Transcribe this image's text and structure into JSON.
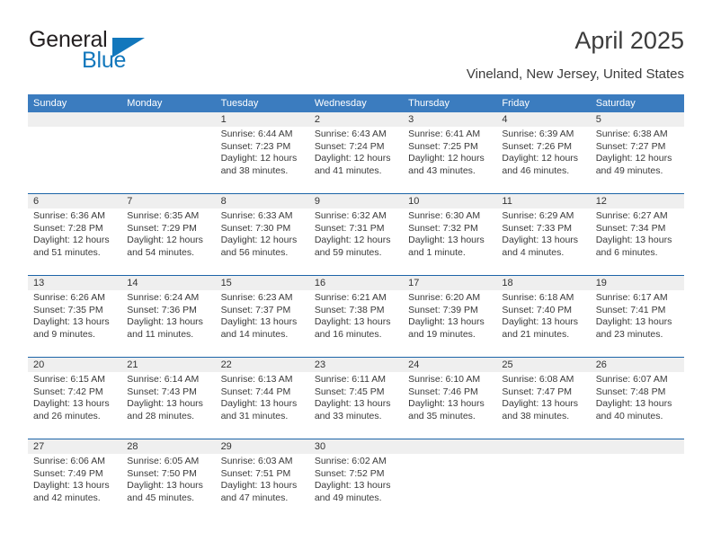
{
  "brand": {
    "name_part1": "General",
    "name_part2": "Blue",
    "flag_icon": "triangle-flag-icon"
  },
  "header": {
    "month_title": "April 2025",
    "location": "Vineland, New Jersey, United States"
  },
  "colors": {
    "header_blue": "#3b7cbf",
    "separator_blue": "#1d65a8",
    "band_gray": "#efefef",
    "brand_blue": "#1277bc",
    "text": "#3a3a3a"
  },
  "calendar": {
    "weekday_headers": [
      "Sunday",
      "Monday",
      "Tuesday",
      "Wednesday",
      "Thursday",
      "Friday",
      "Saturday"
    ],
    "weeks": [
      [
        {
          "day": "",
          "sunrise": "",
          "sunset": "",
          "daylight_line1": "",
          "daylight_line2": ""
        },
        {
          "day": "",
          "sunrise": "",
          "sunset": "",
          "daylight_line1": "",
          "daylight_line2": ""
        },
        {
          "day": "1",
          "sunrise": "Sunrise: 6:44 AM",
          "sunset": "Sunset: 7:23 PM",
          "daylight_line1": "Daylight: 12 hours",
          "daylight_line2": "and 38 minutes."
        },
        {
          "day": "2",
          "sunrise": "Sunrise: 6:43 AM",
          "sunset": "Sunset: 7:24 PM",
          "daylight_line1": "Daylight: 12 hours",
          "daylight_line2": "and 41 minutes."
        },
        {
          "day": "3",
          "sunrise": "Sunrise: 6:41 AM",
          "sunset": "Sunset: 7:25 PM",
          "daylight_line1": "Daylight: 12 hours",
          "daylight_line2": "and 43 minutes."
        },
        {
          "day": "4",
          "sunrise": "Sunrise: 6:39 AM",
          "sunset": "Sunset: 7:26 PM",
          "daylight_line1": "Daylight: 12 hours",
          "daylight_line2": "and 46 minutes."
        },
        {
          "day": "5",
          "sunrise": "Sunrise: 6:38 AM",
          "sunset": "Sunset: 7:27 PM",
          "daylight_line1": "Daylight: 12 hours",
          "daylight_line2": "and 49 minutes."
        }
      ],
      [
        {
          "day": "6",
          "sunrise": "Sunrise: 6:36 AM",
          "sunset": "Sunset: 7:28 PM",
          "daylight_line1": "Daylight: 12 hours",
          "daylight_line2": "and 51 minutes."
        },
        {
          "day": "7",
          "sunrise": "Sunrise: 6:35 AM",
          "sunset": "Sunset: 7:29 PM",
          "daylight_line1": "Daylight: 12 hours",
          "daylight_line2": "and 54 minutes."
        },
        {
          "day": "8",
          "sunrise": "Sunrise: 6:33 AM",
          "sunset": "Sunset: 7:30 PM",
          "daylight_line1": "Daylight: 12 hours",
          "daylight_line2": "and 56 minutes."
        },
        {
          "day": "9",
          "sunrise": "Sunrise: 6:32 AM",
          "sunset": "Sunset: 7:31 PM",
          "daylight_line1": "Daylight: 12 hours",
          "daylight_line2": "and 59 minutes."
        },
        {
          "day": "10",
          "sunrise": "Sunrise: 6:30 AM",
          "sunset": "Sunset: 7:32 PM",
          "daylight_line1": "Daylight: 13 hours",
          "daylight_line2": "and 1 minute."
        },
        {
          "day": "11",
          "sunrise": "Sunrise: 6:29 AM",
          "sunset": "Sunset: 7:33 PM",
          "daylight_line1": "Daylight: 13 hours",
          "daylight_line2": "and 4 minutes."
        },
        {
          "day": "12",
          "sunrise": "Sunrise: 6:27 AM",
          "sunset": "Sunset: 7:34 PM",
          "daylight_line1": "Daylight: 13 hours",
          "daylight_line2": "and 6 minutes."
        }
      ],
      [
        {
          "day": "13",
          "sunrise": "Sunrise: 6:26 AM",
          "sunset": "Sunset: 7:35 PM",
          "daylight_line1": "Daylight: 13 hours",
          "daylight_line2": "and 9 minutes."
        },
        {
          "day": "14",
          "sunrise": "Sunrise: 6:24 AM",
          "sunset": "Sunset: 7:36 PM",
          "daylight_line1": "Daylight: 13 hours",
          "daylight_line2": "and 11 minutes."
        },
        {
          "day": "15",
          "sunrise": "Sunrise: 6:23 AM",
          "sunset": "Sunset: 7:37 PM",
          "daylight_line1": "Daylight: 13 hours",
          "daylight_line2": "and 14 minutes."
        },
        {
          "day": "16",
          "sunrise": "Sunrise: 6:21 AM",
          "sunset": "Sunset: 7:38 PM",
          "daylight_line1": "Daylight: 13 hours",
          "daylight_line2": "and 16 minutes."
        },
        {
          "day": "17",
          "sunrise": "Sunrise: 6:20 AM",
          "sunset": "Sunset: 7:39 PM",
          "daylight_line1": "Daylight: 13 hours",
          "daylight_line2": "and 19 minutes."
        },
        {
          "day": "18",
          "sunrise": "Sunrise: 6:18 AM",
          "sunset": "Sunset: 7:40 PM",
          "daylight_line1": "Daylight: 13 hours",
          "daylight_line2": "and 21 minutes."
        },
        {
          "day": "19",
          "sunrise": "Sunrise: 6:17 AM",
          "sunset": "Sunset: 7:41 PM",
          "daylight_line1": "Daylight: 13 hours",
          "daylight_line2": "and 23 minutes."
        }
      ],
      [
        {
          "day": "20",
          "sunrise": "Sunrise: 6:15 AM",
          "sunset": "Sunset: 7:42 PM",
          "daylight_line1": "Daylight: 13 hours",
          "daylight_line2": "and 26 minutes."
        },
        {
          "day": "21",
          "sunrise": "Sunrise: 6:14 AM",
          "sunset": "Sunset: 7:43 PM",
          "daylight_line1": "Daylight: 13 hours",
          "daylight_line2": "and 28 minutes."
        },
        {
          "day": "22",
          "sunrise": "Sunrise: 6:13 AM",
          "sunset": "Sunset: 7:44 PM",
          "daylight_line1": "Daylight: 13 hours",
          "daylight_line2": "and 31 minutes."
        },
        {
          "day": "23",
          "sunrise": "Sunrise: 6:11 AM",
          "sunset": "Sunset: 7:45 PM",
          "daylight_line1": "Daylight: 13 hours",
          "daylight_line2": "and 33 minutes."
        },
        {
          "day": "24",
          "sunrise": "Sunrise: 6:10 AM",
          "sunset": "Sunset: 7:46 PM",
          "daylight_line1": "Daylight: 13 hours",
          "daylight_line2": "and 35 minutes."
        },
        {
          "day": "25",
          "sunrise": "Sunrise: 6:08 AM",
          "sunset": "Sunset: 7:47 PM",
          "daylight_line1": "Daylight: 13 hours",
          "daylight_line2": "and 38 minutes."
        },
        {
          "day": "26",
          "sunrise": "Sunrise: 6:07 AM",
          "sunset": "Sunset: 7:48 PM",
          "daylight_line1": "Daylight: 13 hours",
          "daylight_line2": "and 40 minutes."
        }
      ],
      [
        {
          "day": "27",
          "sunrise": "Sunrise: 6:06 AM",
          "sunset": "Sunset: 7:49 PM",
          "daylight_line1": "Daylight: 13 hours",
          "daylight_line2": "and 42 minutes."
        },
        {
          "day": "28",
          "sunrise": "Sunrise: 6:05 AM",
          "sunset": "Sunset: 7:50 PM",
          "daylight_line1": "Daylight: 13 hours",
          "daylight_line2": "and 45 minutes."
        },
        {
          "day": "29",
          "sunrise": "Sunrise: 6:03 AM",
          "sunset": "Sunset: 7:51 PM",
          "daylight_line1": "Daylight: 13 hours",
          "daylight_line2": "and 47 minutes."
        },
        {
          "day": "30",
          "sunrise": "Sunrise: 6:02 AM",
          "sunset": "Sunset: 7:52 PM",
          "daylight_line1": "Daylight: 13 hours",
          "daylight_line2": "and 49 minutes."
        },
        {
          "day": "",
          "sunrise": "",
          "sunset": "",
          "daylight_line1": "",
          "daylight_line2": ""
        },
        {
          "day": "",
          "sunrise": "",
          "sunset": "",
          "daylight_line1": "",
          "daylight_line2": ""
        },
        {
          "day": "",
          "sunrise": "",
          "sunset": "",
          "daylight_line1": "",
          "daylight_line2": ""
        }
      ]
    ]
  }
}
